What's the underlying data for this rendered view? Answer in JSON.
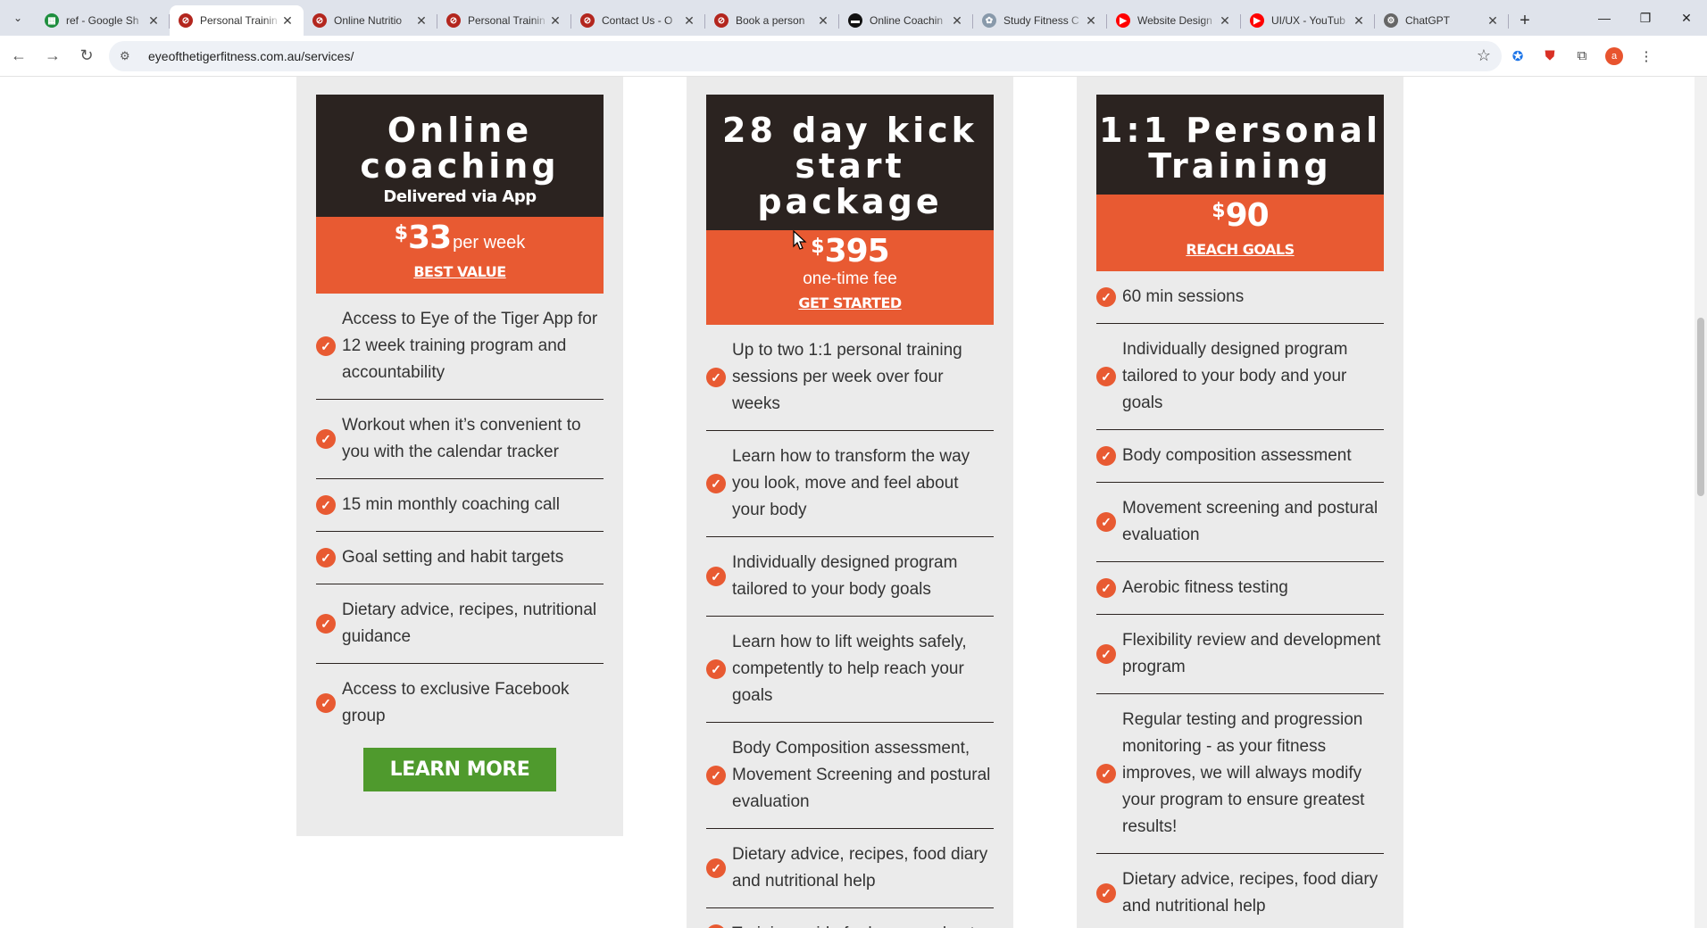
{
  "browser": {
    "tabs": [
      {
        "title": "ref - Google Sh",
        "favicon_color": "#1e8e3e",
        "favicon_glyph": "▦",
        "active": false
      },
      {
        "title": "Personal Trainin",
        "favicon_color": "#b3261e",
        "favicon_glyph": "⊘",
        "active": true
      },
      {
        "title": "Online Nutritio",
        "favicon_color": "#b3261e",
        "favicon_glyph": "⊘",
        "active": false
      },
      {
        "title": "Personal Trainin",
        "favicon_color": "#b3261e",
        "favicon_glyph": "⊘",
        "active": false
      },
      {
        "title": "Contact Us - O",
        "favicon_color": "#b3261e",
        "favicon_glyph": "⊘",
        "active": false
      },
      {
        "title": "Book a person",
        "favicon_color": "#b3261e",
        "favicon_glyph": "⊘",
        "active": false
      },
      {
        "title": "Online Coachin",
        "favicon_color": "#111111",
        "favicon_glyph": "▬",
        "active": false
      },
      {
        "title": "Study Fitness C",
        "favicon_color": "#8899aa",
        "favicon_glyph": "✿",
        "active": false
      },
      {
        "title": "Website Design",
        "favicon_color": "#ff0000",
        "favicon_glyph": "▶",
        "active": false
      },
      {
        "title": "UI/UX - YouTub",
        "favicon_color": "#ff0000",
        "favicon_glyph": "▶",
        "active": false
      },
      {
        "title": "ChatGPT",
        "favicon_color": "#666666",
        "favicon_glyph": "⚙",
        "active": false
      }
    ],
    "url": "eyeofthetigerfitness.com.au/services/",
    "avatar_letter": "a"
  },
  "cards": [
    {
      "title_line1": "Online",
      "title_line2": "coaching",
      "subtitle": "Delivered via App",
      "price_symbol": "$",
      "price": "33",
      "price_unit": "per week",
      "price_note": "",
      "link": "BEST VALUE",
      "features": [
        "Access to Eye of the Tiger App for 12 week training program and accountability",
        "Workout when it’s convenient to you with the calendar tracker",
        "15 min monthly coaching call",
        "Goal setting and habit targets",
        "Dietary advice, recipes, nutritional guidance",
        "Access to exclusive Facebook group"
      ],
      "button": "LEARN MORE"
    },
    {
      "title_line1": "28 day kick",
      "title_line2": "start package",
      "subtitle": "",
      "price_symbol": "$",
      "price": "395",
      "price_unit": "",
      "price_note": "one-time fee",
      "link": "GET STARTED",
      "features": [
        "Up to two 1:1 personal training sessions per week over four weeks",
        "Learn how to transform the way you look, move and feel about your body",
        "Individually designed program tailored to your body goals",
        "Learn how to lift weights safely, competently to help reach your goals",
        "Body Composition assessment, Movement Screening and postural evaluation",
        "Dietary advice, recipes, food diary and nutritional help",
        "Training guide for home workouts"
      ],
      "button": ""
    },
    {
      "title_line1": "1:1 Personal",
      "title_line2": "Training",
      "subtitle": "",
      "price_symbol": "$",
      "price": "90",
      "price_unit": "",
      "price_note": "",
      "link": "REACH GOALS",
      "features": [
        "60 min sessions",
        "Individually designed program tailored to your body and your goals",
        "Body composition assessment",
        "Movement screening and postural evaluation",
        "Aerobic fitness testing",
        "Flexibility review and development program",
        "Regular testing and progression monitoring - as your fitness improves, we will always modify your program to ensure greatest results!",
        "Dietary advice, recipes, food diary and nutritional help"
      ],
      "button": ""
    }
  ],
  "colors": {
    "dark_header": "#2b2320",
    "orange": "#e85a32",
    "green_button": "#4f9a2d",
    "card_bg": "#ebebeb"
  }
}
